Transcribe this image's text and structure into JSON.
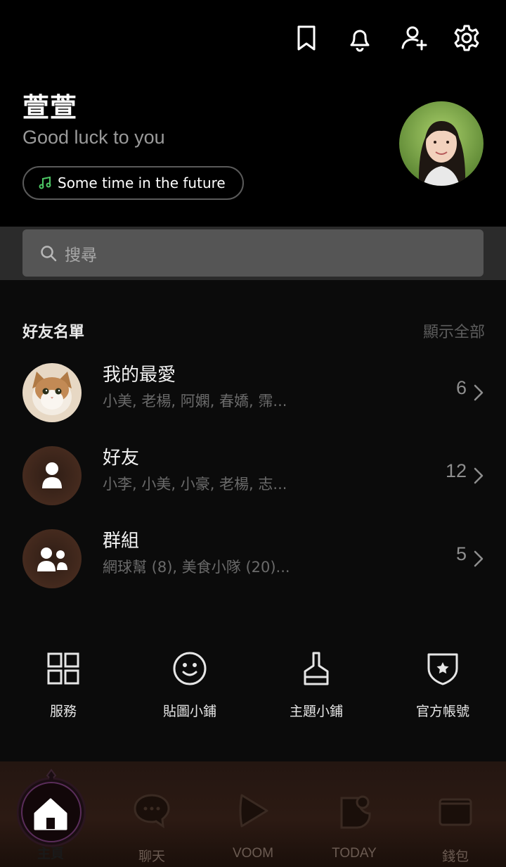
{
  "header": {
    "icons": [
      "bookmark-icon",
      "bell-icon",
      "add-friend-icon",
      "gear-icon"
    ]
  },
  "profile": {
    "name": "萱萱",
    "status": "Good luck to you",
    "music": "Some time in the future"
  },
  "search": {
    "placeholder": "搜尋"
  },
  "friends": {
    "title": "好友名單",
    "show_all": "顯示全部",
    "rows": [
      {
        "title": "我的最愛",
        "subtitle": "小美, 老楊, 阿嫻, 春嬌, 霈...",
        "count": "6"
      },
      {
        "title": "好友",
        "subtitle": "小李, 小美, 小豪, 老楊, 志...",
        "count": "12"
      },
      {
        "title": "群組",
        "subtitle": "網球幫 (8), 美食小隊 (20)...",
        "count": "5"
      }
    ]
  },
  "shortcuts": [
    {
      "label": "服務",
      "icon": "grid-icon"
    },
    {
      "label": "貼圖小鋪",
      "icon": "smiley-icon"
    },
    {
      "label": "主題小鋪",
      "icon": "brush-icon"
    },
    {
      "label": "官方帳號",
      "icon": "shield-star-icon"
    }
  ],
  "nav": [
    {
      "label": "主頁",
      "icon": "home-icon",
      "active": true
    },
    {
      "label": "聊天",
      "icon": "chat-icon"
    },
    {
      "label": "VOOM",
      "icon": "play-icon"
    },
    {
      "label": "TODAY",
      "icon": "today-icon"
    },
    {
      "label": "錢包",
      "icon": "wallet-icon"
    }
  ],
  "colors": {
    "background": "#000000",
    "search_band": "#2b2b2b",
    "music_note": "#4cc764"
  }
}
